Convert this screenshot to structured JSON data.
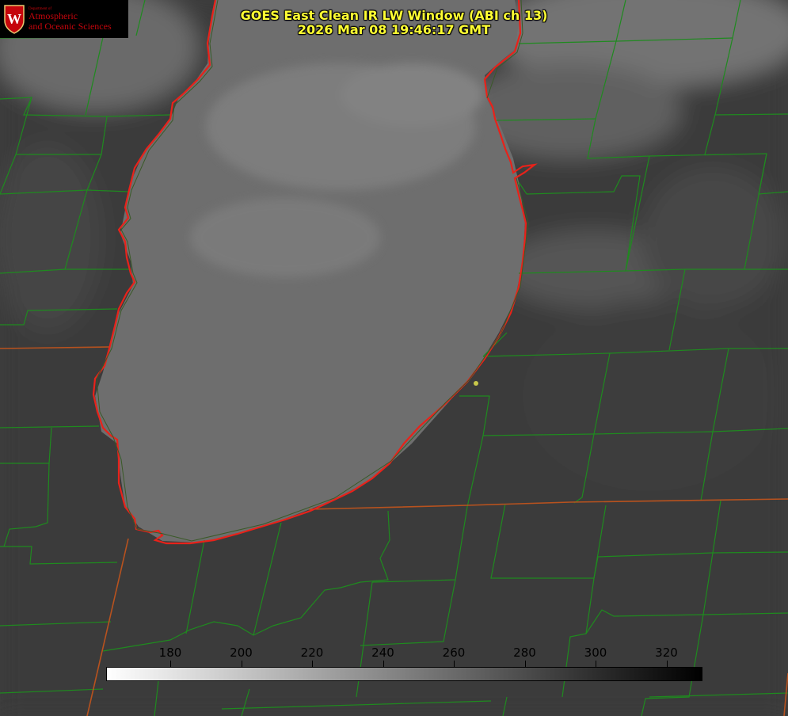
{
  "title": {
    "line1": "GOES East Clean IR LW Window (ABI ch 13)",
    "line2": "2026 Mar 08 19:46:17 GMT"
  },
  "logo": {
    "dept": "Department of",
    "line1": "Atmospheric",
    "line2": "and Oceanic Sciences",
    "seal_letter": "W"
  },
  "colorbar": {
    "ticks": [
      "180",
      "200",
      "220",
      "240",
      "260",
      "280",
      "300",
      "320"
    ],
    "scale": "white-to-black grayscale"
  },
  "colors": {
    "coastline": "#e8221a",
    "county_lines": "#1f8a1f",
    "state_lines": "#b8521e",
    "title_text": "#ffff33",
    "logo_red": "#c5050c"
  }
}
